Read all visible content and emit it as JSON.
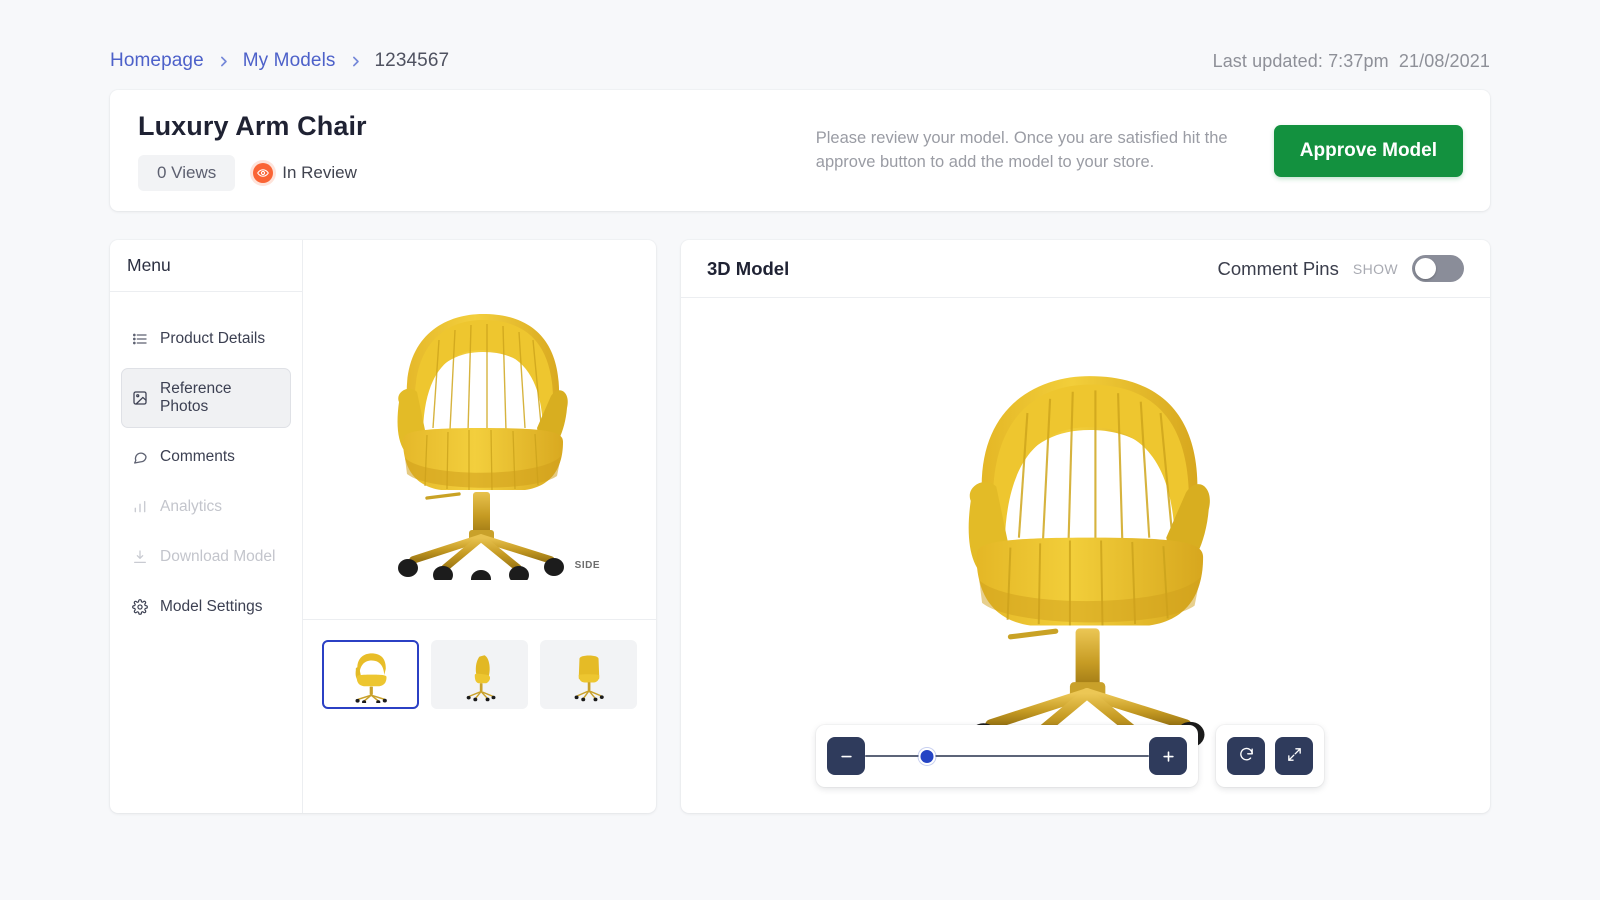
{
  "breadcrumb": {
    "items": [
      {
        "label": "Homepage",
        "type": "link"
      },
      {
        "label": "My Models",
        "type": "link"
      },
      {
        "label": "1234567",
        "type": "current"
      }
    ],
    "separator_icon": "chevron-right-icon"
  },
  "last_updated": "Last updated: 7:37pm  21/08/2021",
  "header": {
    "title": "Luxury Arm Chair",
    "views_badge": "0 Views",
    "status_label": "In Review",
    "status_icon": "eye-icon",
    "status_color": "#fa6434",
    "review_note": "Please review your model. Once you are satisfied hit the approve button to add the model to your store.",
    "approve_label": "Approve Model",
    "approve_color": "#13913f"
  },
  "sidebar": {
    "heading": "Menu",
    "items": [
      {
        "label": "Product Details",
        "icon": "list-icon",
        "state": "default"
      },
      {
        "label": "Reference Photos",
        "icon": "image-icon",
        "state": "active"
      },
      {
        "label": "Comments",
        "icon": "comment-icon",
        "state": "default"
      },
      {
        "label": "Analytics",
        "icon": "bar-chart-icon",
        "state": "disabled"
      },
      {
        "label": "Download Model",
        "icon": "download-icon",
        "state": "disabled"
      },
      {
        "label": "Model Settings",
        "icon": "gear-icon",
        "state": "default"
      }
    ]
  },
  "reference_photos": {
    "main_watermark": "SIDE",
    "main_alt": "Yellow velvet arm chair, three-quarter view",
    "thumbnails": [
      {
        "alt": "Chair three-quarter view",
        "selected": true
      },
      {
        "alt": "Chair side view",
        "selected": false
      },
      {
        "alt": "Chair back view",
        "selected": false
      }
    ],
    "selected_border_color": "#2b40c4"
  },
  "viewer": {
    "title": "3D Model",
    "comment_pins_label": "Comment Pins",
    "toggle_state_label": "SHOW",
    "toggle_on": false,
    "model_alt": "Yellow velvet arm chair 3D model",
    "controls": {
      "zoom_out_icon": "minus-icon",
      "zoom_in_icon": "plus-icon",
      "zoom_percent": 22,
      "reset_icon": "rotate-icon",
      "fullscreen_icon": "expand-icon"
    }
  }
}
